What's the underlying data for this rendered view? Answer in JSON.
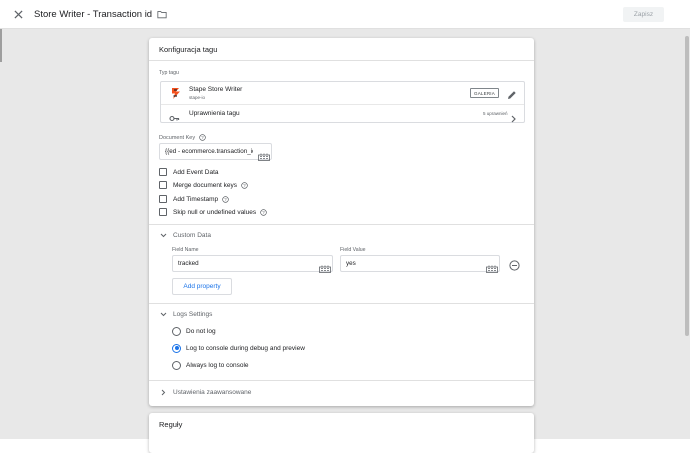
{
  "header": {
    "title": "Store Writer - Transaction id",
    "save_label": "Zapisz",
    "close_icon": "close-icon",
    "folder_icon": "folder-icon"
  },
  "config_card": {
    "title": "Konfiguracja tagu",
    "tag_type": {
      "label": "Typ tagu",
      "name": "Stape Store Writer",
      "vendor": "stape-io",
      "gallery_badge": "GALERIA",
      "permissions_label": "Uprawnienia tagu",
      "permissions_count": "5 uprawnień"
    },
    "document_key": {
      "label": "Document Key",
      "value": "{{ed - ecommerce.transaction_id}}"
    },
    "checkboxes": [
      {
        "label": "Add Event Data",
        "checked": false,
        "has_help": true
      },
      {
        "label": "Merge document keys",
        "checked": false,
        "has_help": true
      },
      {
        "label": "Add Timestamp",
        "checked": false,
        "has_help": true
      },
      {
        "label": "Skip null or undefined values",
        "checked": false,
        "has_help": true
      }
    ],
    "custom_data": {
      "section_label": "Custom Data",
      "field_name_label": "Field Name",
      "field_value_label": "Field Value",
      "rows": [
        {
          "name": "tracked",
          "value": "yes"
        }
      ],
      "add_button": "Add property"
    },
    "logs_settings": {
      "section_label": "Logs Settings",
      "options": [
        {
          "label": "Do not log",
          "checked": false
        },
        {
          "label": "Log to console during debug and preview",
          "checked": true
        },
        {
          "label": "Always log to console",
          "checked": false
        }
      ]
    },
    "advanced": {
      "section_label": "Ustawienia zaawansowane"
    }
  },
  "rules_card": {
    "title": "Reguły"
  },
  "colors": {
    "accent": "#1a73e8",
    "stape_orange": "#f4511e",
    "backdrop": "#e8e8e8"
  }
}
